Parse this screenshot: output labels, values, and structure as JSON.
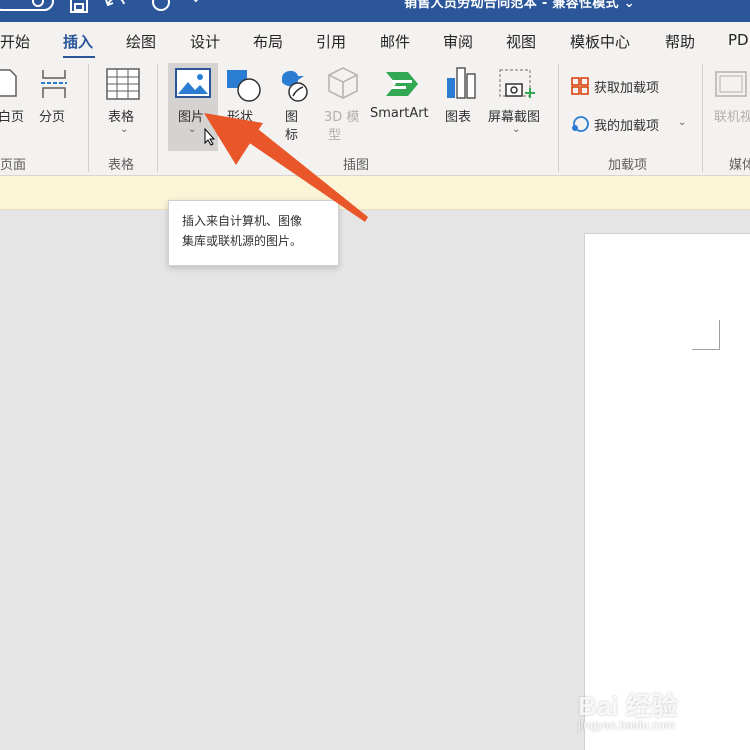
{
  "titlebar": {
    "doc_title": "销售人员劳动合同范本 - 兼容性模式",
    "title_chevron": "⌄",
    "more_chevron": "⌄"
  },
  "tabs": [
    {
      "label": "开始"
    },
    {
      "label": "插入",
      "active": true
    },
    {
      "label": "绘图"
    },
    {
      "label": "设计"
    },
    {
      "label": "布局"
    },
    {
      "label": "引用"
    },
    {
      "label": "邮件"
    },
    {
      "label": "审阅"
    },
    {
      "label": "视图"
    },
    {
      "label": "模板中心"
    },
    {
      "label": "帮助"
    },
    {
      "label": "PD"
    }
  ],
  "ribbon": {
    "pages_group": {
      "blank_page": "白页",
      "page_break": "分页",
      "label": "页面"
    },
    "tables_group": {
      "table": "表格",
      "table_chevron": "⌄",
      "label": "表格"
    },
    "illustrations_group": {
      "pictures": "图片",
      "pictures_chevron": "⌄",
      "shapes": "形状",
      "icons_line1": "图",
      "icons_line2": "标",
      "model3d_line1": "3D 模",
      "model3d_line2": "型",
      "smartart": "SmartArt",
      "chart": "图表",
      "screenshot": "屏幕截图",
      "screenshot_chevron": "⌄",
      "label": "插图"
    },
    "addins_group": {
      "get_addins": "获取加载项",
      "my_addins": "我的加载项",
      "my_addins_chevron": "⌄",
      "label": "加载项"
    },
    "media_group": {
      "online_video": "联机视",
      "label": "媒体"
    }
  },
  "tooltip": {
    "line1": "插入来自计算机、图像",
    "line2": "集库或联机源的图片。"
  },
  "watermark": {
    "brand": "Bai 经验",
    "url": "jingyan.baidu.com"
  },
  "colors": {
    "title_bar": "#2b579a",
    "ribbon_bg": "#f3f2f1",
    "canvas_bg": "#e5e5e5",
    "arrow": "#e8562a",
    "highlight": "#d5d3d1"
  }
}
